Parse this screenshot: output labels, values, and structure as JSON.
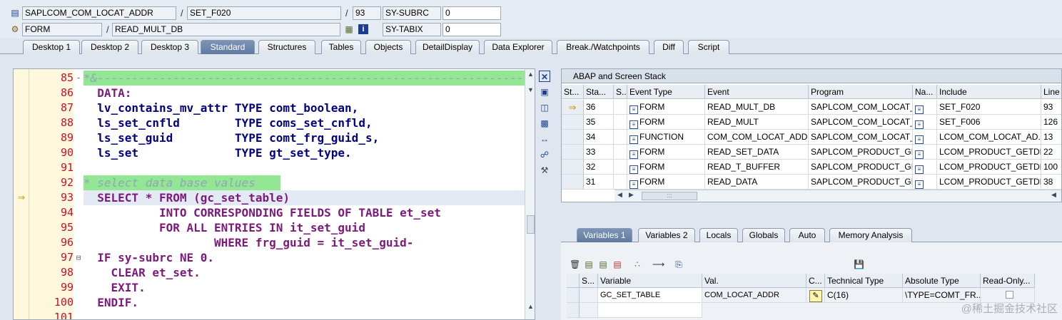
{
  "header": {
    "row1": {
      "program": "SAPLCOM_COM_LOCAT_ADDR",
      "include": "SET_F020",
      "line": "93",
      "sysvar1_name": "SY-SUBRC",
      "sysvar1_value": "0"
    },
    "row2": {
      "event_type": "FORM",
      "event": "READ_MULT_DB",
      "sysvar2_name": "SY-TABIX",
      "sysvar2_value": "0"
    },
    "slash": "/"
  },
  "tabs": [
    {
      "label": "Desktop 1"
    },
    {
      "label": "Desktop 2"
    },
    {
      "label": "Desktop 3"
    },
    {
      "label": "Standard",
      "active": true
    },
    {
      "label": "Structures"
    },
    {
      "label": "Tables"
    },
    {
      "label": "Objects"
    },
    {
      "label": "DetailDisplay"
    },
    {
      "label": "Data Explorer"
    },
    {
      "label": "Break./Watchpoints"
    },
    {
      "label": "Diff"
    },
    {
      "label": "Script"
    }
  ],
  "editor": {
    "current_line": "93",
    "lines": [
      {
        "num": "85",
        "text": "*&---------------------------------------------------------------------"
      },
      {
        "num": "86",
        "text": "  DATA:"
      },
      {
        "num": "87",
        "text": "  lv_contains_mv_attr TYPE comt_boolean,"
      },
      {
        "num": "88",
        "text": "  ls_set_cnfld        TYPE coms_set_cnfld,"
      },
      {
        "num": "89",
        "text": "  ls_set_guid         TYPE comt_frg_guid_s,"
      },
      {
        "num": "90",
        "text": "  ls_set              TYPE gt_set_type."
      },
      {
        "num": "91",
        "text": ""
      },
      {
        "num": "92",
        "text": "* select data base values"
      },
      {
        "num": "93",
        "text": "  SELECT * FROM (gc_set_table)"
      },
      {
        "num": "94",
        "text": "           INTO CORRESPONDING FIELDS OF TABLE et_set"
      },
      {
        "num": "95",
        "text": "           FOR ALL ENTRIES IN it_set_guid"
      },
      {
        "num": "96",
        "text": "                   WHERE frg_guid = it_set_guid-"
      },
      {
        "num": "97",
        "text": "  IF sy-subrc NE 0."
      },
      {
        "num": "98",
        "text": "    CLEAR et_set."
      },
      {
        "num": "99",
        "text": "    EXIT."
      },
      {
        "num": "100",
        "text": "  ENDIF."
      },
      {
        "num": "101",
        "text": ""
      }
    ]
  },
  "stack": {
    "title": "ABAP and Screen Stack",
    "columns": [
      "St...",
      "Sta...",
      "S...",
      "Event Type",
      "Event",
      "Program",
      "Na...",
      "Include",
      "Line"
    ],
    "rows": [
      {
        "level": "36",
        "event_type": "FORM",
        "event": "READ_MULT_DB",
        "program": "SAPLCOM_COM_LOCAT_...",
        "include": "SET_F020",
        "line": "93",
        "current": true
      },
      {
        "level": "35",
        "event_type": "FORM",
        "event": "READ_MULT",
        "program": "SAPLCOM_COM_LOCAT_...",
        "include": "SET_F006",
        "line": "126"
      },
      {
        "level": "34",
        "event_type": "FUNCTION",
        "event": "COM_COM_LOCAT_ADD...",
        "program": "SAPLCOM_COM_LOCAT_...",
        "include": "LCOM_COM_LOCAT_AD...",
        "line": "13"
      },
      {
        "level": "33",
        "event_type": "FORM",
        "event": "READ_SET_DATA",
        "program": "SAPLCOM_PRODUCT_GE...",
        "include": "LCOM_PRODUCT_GETDE...",
        "line": "22"
      },
      {
        "level": "32",
        "event_type": "FORM",
        "event": "READ_T_BUFFER",
        "program": "SAPLCOM_PRODUCT_GE...",
        "include": "LCOM_PRODUCT_GETDE...",
        "line": "100"
      },
      {
        "level": "31",
        "event_type": "FORM",
        "event": "READ_DATA",
        "program": "SAPLCOM_PRODUCT_GE...",
        "include": "LCOM_PRODUCT_GETDE...",
        "line": "38"
      }
    ],
    "hscroll_grip": ":::"
  },
  "var_tabs": [
    {
      "label": "Variables 1",
      "active": true
    },
    {
      "label": "Variables 2"
    },
    {
      "label": "Locals"
    },
    {
      "label": "Globals"
    },
    {
      "label": "Auto"
    },
    {
      "label": "Memory Analysis"
    }
  ],
  "variables": {
    "columns": [
      "S...",
      "Variable",
      "Val.",
      "C...",
      "Technical Type",
      "Absolute Type",
      "Read-Only..."
    ],
    "rows": [
      {
        "variable": "GC_SET_TABLE",
        "value": "COM_LOCAT_ADDR",
        "technical_type": "C(16)",
        "absolute_type": "\\TYPE=COMT_FR..."
      }
    ]
  },
  "watermark": "@稀土掘金技术社区"
}
